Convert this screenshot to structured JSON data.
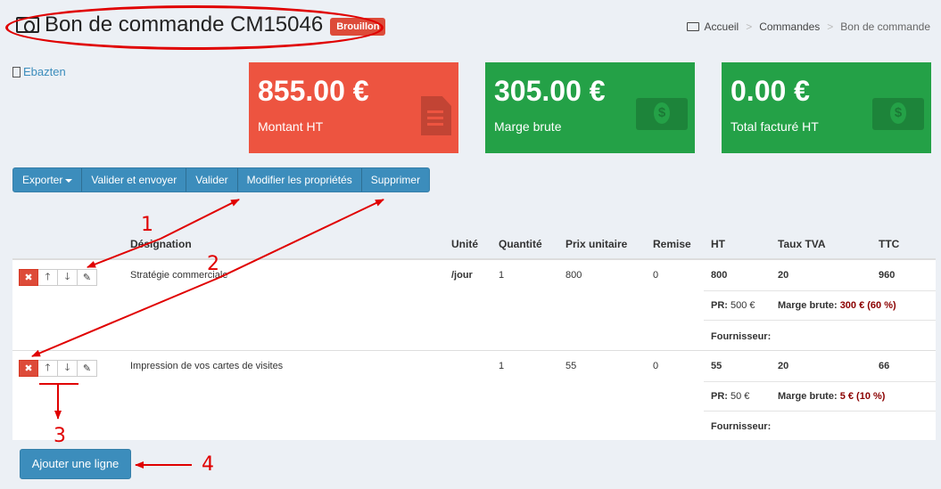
{
  "header": {
    "title": "Bon de commande CM15046",
    "status_badge": "Brouillon",
    "breadcrumb": [
      "Accueil",
      "Commandes",
      "Bon de commande"
    ]
  },
  "client": {
    "name": "Ebazten"
  },
  "stats": [
    {
      "value": "855.00 €",
      "label": "Montant HT",
      "color": "#ed5440",
      "icon": "file-icon"
    },
    {
      "value": "305.00 €",
      "label": "Marge brute",
      "color": "#24a147",
      "icon": "money-icon"
    },
    {
      "value": "0.00 €",
      "label": "Total facturé HT",
      "color": "#24a147",
      "icon": "money-icon"
    }
  ],
  "toolbar": {
    "export": "Exporter",
    "validate_send": "Valider et envoyer",
    "validate": "Valider",
    "edit_props": "Modifier les propriétés",
    "delete": "Supprimer"
  },
  "table": {
    "columns": [
      "Désignation",
      "Unité",
      "Quantité",
      "Prix unitaire",
      "Remise",
      "HT",
      "Taux TVA",
      "TTC"
    ],
    "rows": [
      {
        "designation": "Stratégie commerciale",
        "unit": "/jour",
        "quantity": "1",
        "unit_price": "800",
        "discount": "0",
        "ht": "800",
        "vat": "20",
        "ttc": "960",
        "pr_label": "PR:",
        "pr_value": "500 €",
        "margin_label": "Marge brute:",
        "margin_value": "300 € (60 %)",
        "supplier_label": "Fournisseur:"
      },
      {
        "designation": "Impression de vos cartes de visites",
        "unit": "",
        "quantity": "1",
        "unit_price": "55",
        "discount": "0",
        "ht": "55",
        "vat": "20",
        "ttc": "66",
        "pr_label": "PR:",
        "pr_value": "50 €",
        "margin_label": "Marge brute:",
        "margin_value": "5 € (10 %)",
        "supplier_label": "Fournisseur:"
      }
    ],
    "add_line": "Ajouter une ligne"
  },
  "annotations": [
    "1",
    "2",
    "3",
    "4"
  ],
  "colors": {
    "primary": "#3c8dbc",
    "danger": "#dd4b39",
    "success": "#24a147",
    "annotation": "#e00000"
  }
}
